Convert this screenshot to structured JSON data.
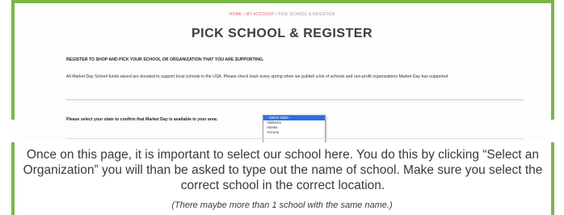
{
  "breadcrumb": {
    "home": "HOME",
    "separator": " / ",
    "account": "MY ACCOUNT",
    "current": "PICK SCHOOL & REGISTER"
  },
  "page": {
    "title": "PICK SCHOOL & REGISTER",
    "intro_heading": "REGISTER TO SHOP AND PICK YOUR SCHOOL OR ORGANIZATION THAT YOU ARE SUPPORTING.",
    "intro_body": "All Market Day School funds raised are donated to support local schools in the USA. Please check back every spring when we publish a list of schools and non-profit organizations Market Day has supported.",
    "state_prompt": "Please select your state to confirm that Market Day is available in your area:"
  },
  "state_select": {
    "options": [
      "- Select State -",
      "Alabama",
      "Alaska",
      "Arizona"
    ],
    "selected_index": 0
  },
  "caption": {
    "main": "Once on this page, it is important to select our school here. You do this by clicking “Select an Organization” you will than be asked to type out the name of school. Make sure you select the correct school in the correct location.",
    "note": "(There maybe more than 1 school with the same name.)"
  },
  "colors": {
    "frame_accent": "#7ab648",
    "breadcrumb_link": "#e06767",
    "dropdown_highlight": "#2f6fd8"
  }
}
